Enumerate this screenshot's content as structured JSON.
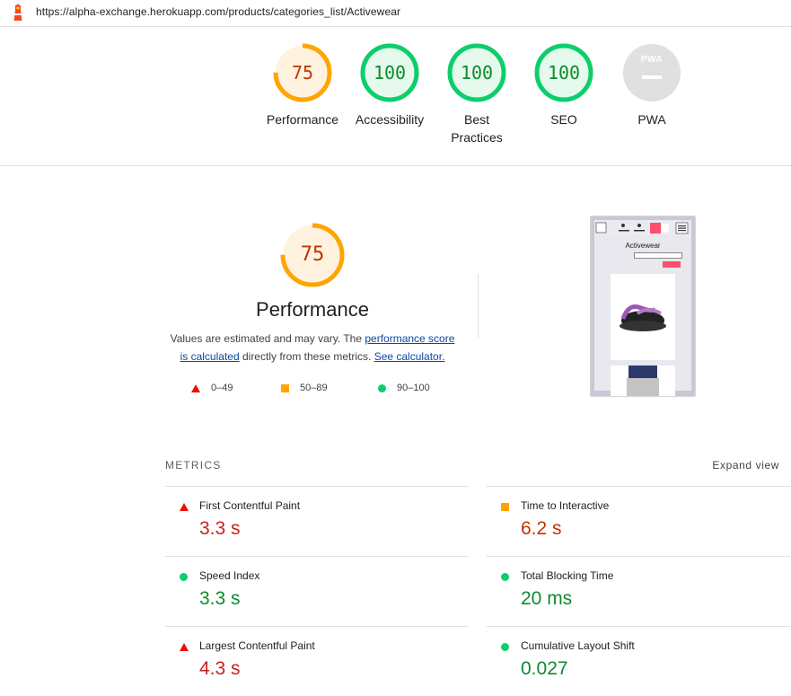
{
  "browser": {
    "url": "https://alpha-exchange.herokuapp.com/products/categories_list/Activewear",
    "logo_icon": "lighthouse-icon"
  },
  "colors": {
    "fail": "#eb0f00",
    "average": "#ffa400",
    "pass": "#0cce6b",
    "link": "#0d47a1"
  },
  "summary": [
    {
      "label": "Performance",
      "score": "75",
      "rating": "average"
    },
    {
      "label": "Accessibility",
      "score": "100",
      "rating": "pass"
    },
    {
      "label": "Best Practices",
      "score": "100",
      "rating": "pass"
    },
    {
      "label": "SEO",
      "score": "100",
      "rating": "pass"
    },
    {
      "label": "PWA",
      "score": "PWA",
      "rating": "na"
    }
  ],
  "performance": {
    "score": "75",
    "score_fraction": 0.75,
    "title": "Performance",
    "desc_prefix": "Values are estimated and may vary. The ",
    "link1": "performance score is calculated",
    "desc_mid": " directly from these metrics. ",
    "link2": "See calculator.",
    "legend": [
      {
        "shape": "triangle",
        "range": "0–49"
      },
      {
        "shape": "square",
        "range": "50–89"
      },
      {
        "shape": "circle",
        "range": "90–100"
      }
    ],
    "screenshot": {
      "page_title": "Activewear"
    }
  },
  "metrics": {
    "header": "METRICS",
    "expand": "Expand view",
    "items": [
      {
        "name": "First Contentful Paint",
        "value": "3.3 s",
        "rating": "fail"
      },
      {
        "name": "Time to Interactive",
        "value": "6.2 s",
        "rating": "average"
      },
      {
        "name": "Speed Index",
        "value": "3.3 s",
        "rating": "pass"
      },
      {
        "name": "Total Blocking Time",
        "value": "20 ms",
        "rating": "pass"
      },
      {
        "name": "Largest Contentful Paint",
        "value": "4.3 s",
        "rating": "fail"
      },
      {
        "name": "Cumulative Layout Shift",
        "value": "0.027",
        "rating": "pass"
      }
    ]
  }
}
